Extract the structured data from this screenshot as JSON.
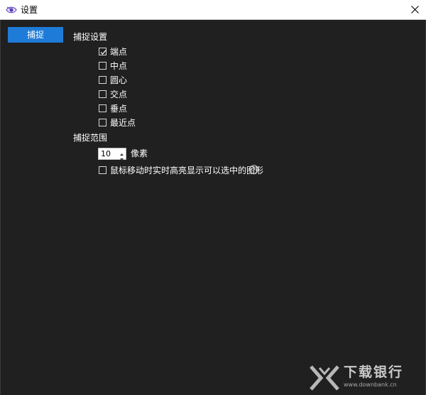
{
  "window": {
    "title": "设置",
    "icon": "app-eye-icon",
    "close_icon": "close-icon"
  },
  "tabs": [
    {
      "label": "捕捉",
      "active": true
    }
  ],
  "snap_settings": {
    "heading": "捕捉设置",
    "options": [
      {
        "label": "端点",
        "checked": true
      },
      {
        "label": "中点",
        "checked": false
      },
      {
        "label": "圆心",
        "checked": false
      },
      {
        "label": "交点",
        "checked": false
      },
      {
        "label": "垂点",
        "checked": false
      },
      {
        "label": "最近点",
        "checked": false
      }
    ]
  },
  "snap_range": {
    "heading": "捕捉范围",
    "value": "10",
    "unit": "像素",
    "highlight_option": {
      "label": "鼠标移动时实时高亮显示可以选中的图形",
      "checked": false
    },
    "help_icon": "help-circle-icon"
  },
  "watermark": {
    "text": "下载银行",
    "url": "www.downbank.cn"
  },
  "colors": {
    "accent": "#1e7bd7",
    "background": "#202020",
    "titlebar": "#ffffff"
  }
}
